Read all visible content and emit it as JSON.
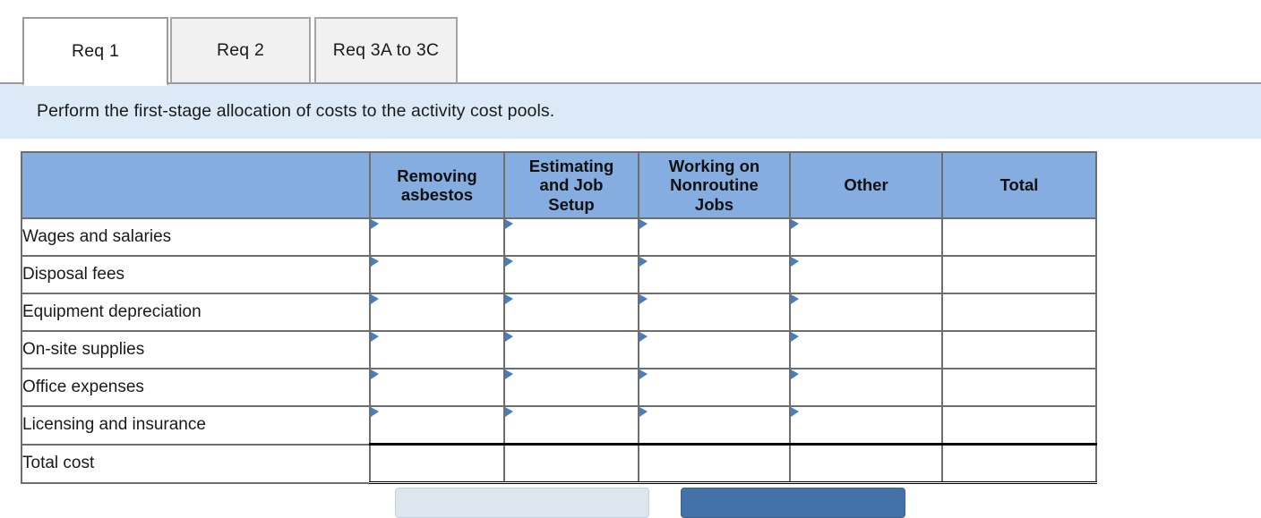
{
  "tabs": [
    {
      "label": "Req 1",
      "active": true
    },
    {
      "label": "Req 2",
      "active": false
    },
    {
      "label": "Req 3A to 3C",
      "active": false
    }
  ],
  "banner": {
    "instruction": "Perform the first-stage allocation of costs to the activity cost pools."
  },
  "table": {
    "corner_header": "",
    "columns": [
      "Removing asbestos",
      "Estimating and Job Setup",
      "Working on Nonroutine Jobs",
      "Other",
      "Total"
    ],
    "column_lines": [
      [
        "Removing",
        "asbestos"
      ],
      [
        "Estimating",
        "and Job",
        "Setup"
      ],
      [
        "Working on",
        "Nonroutine",
        "Jobs"
      ],
      [
        "Other"
      ],
      [
        "Total"
      ]
    ],
    "rows": [
      {
        "label": "Wages and salaries",
        "values": [
          "",
          "",
          "",
          "",
          ""
        ],
        "is_total": false
      },
      {
        "label": "Disposal fees",
        "values": [
          "",
          "",
          "",
          "",
          ""
        ],
        "is_total": false
      },
      {
        "label": "Equipment depreciation",
        "values": [
          "",
          "",
          "",
          "",
          ""
        ],
        "is_total": false
      },
      {
        "label": "On-site supplies",
        "values": [
          "",
          "",
          "",
          "",
          ""
        ],
        "is_total": false
      },
      {
        "label": "Office expenses",
        "values": [
          "",
          "",
          "",
          "",
          ""
        ],
        "is_total": false
      },
      {
        "label": "Licensing and insurance",
        "values": [
          "",
          "",
          "",
          "",
          ""
        ],
        "is_total": false
      },
      {
        "label": "Total cost",
        "values": [
          "",
          "",
          "",
          "",
          ""
        ],
        "is_total": true
      }
    ],
    "marker_icon": "dropdown-triangle-icon"
  },
  "footer": {
    "prev_label": "",
    "next_label": ""
  },
  "colors": {
    "header_blue": "#85ADE0",
    "banner_blue": "#DCEAF7",
    "marker_blue": "#4A7EBB",
    "grid_gray": "#6E6E6E",
    "tab_inactive": "#F1F1F1",
    "button_primary": "#4472A8",
    "button_secondary": "#DDE5EF"
  }
}
